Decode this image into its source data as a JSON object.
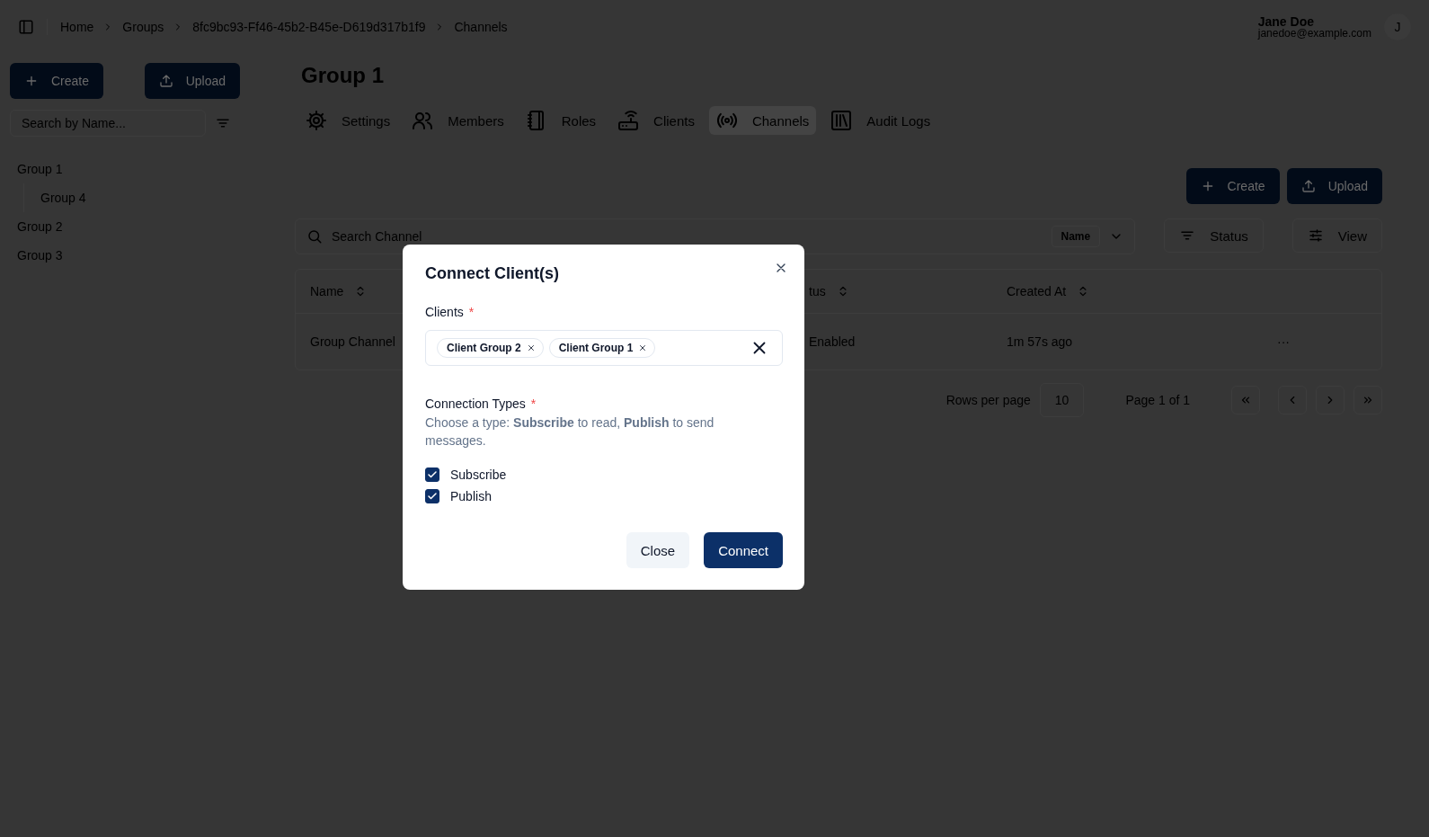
{
  "breadcrumbs": [
    {
      "label": "Home"
    },
    {
      "label": "Groups"
    },
    {
      "label": "8fc9bc93-Ff46-45b2-B45e-D619d317b1f9"
    },
    {
      "label": "Channels"
    }
  ],
  "user": {
    "name": "Jane Doe",
    "email": "janedoe@example.com",
    "initial": "J"
  },
  "sidebar": {
    "create_label": "Create",
    "upload_label": "Upload",
    "search_placeholder": "Search by Name...",
    "tree": [
      {
        "label": "Group 1",
        "children": [
          {
            "label": "Group 4"
          }
        ]
      },
      {
        "label": "Group 2"
      },
      {
        "label": "Group 3"
      }
    ]
  },
  "page_title": "Group 1",
  "tabs": [
    {
      "label": "Settings",
      "selected": false
    },
    {
      "label": "Members",
      "selected": false
    },
    {
      "label": "Roles",
      "selected": false
    },
    {
      "label": "Clients",
      "selected": false
    },
    {
      "label": "Channels",
      "selected": true
    },
    {
      "label": "Audit Logs",
      "selected": false
    }
  ],
  "actions": {
    "create_label": "Create",
    "upload_label": "Upload"
  },
  "toolbar": {
    "search_placeholder": "Search Channel",
    "search_by": "Name",
    "status_label": "Status",
    "view_label": "View"
  },
  "table": {
    "columns": [
      "Name",
      "tus",
      "Created At"
    ],
    "rows": [
      {
        "name": "Group Channel",
        "status": "Enabled",
        "created": "1m 57s ago",
        "actions": "···"
      }
    ]
  },
  "pagination": {
    "rows_label": "Rows per page",
    "rows_value": "10",
    "page_label": "Page 1 of 1"
  },
  "dialog": {
    "title": "Connect Client(s)",
    "clients_field": {
      "label": "Clients",
      "required_mark": "*",
      "chips": [
        "Client Group 2",
        "Client Group 1"
      ]
    },
    "types_field": {
      "label": "Connection Types",
      "required_mark": "*",
      "description": "Choose a type: **Subscribe** to read, **Publish** to send messages.",
      "options": [
        {
          "label": "Subscribe",
          "checked": true
        },
        {
          "label": "Publish",
          "checked": true
        }
      ]
    },
    "buttons": [
      {
        "label": "Close",
        "kind": "secondary"
      },
      {
        "label": "Connect",
        "kind": "primary"
      }
    ]
  }
}
